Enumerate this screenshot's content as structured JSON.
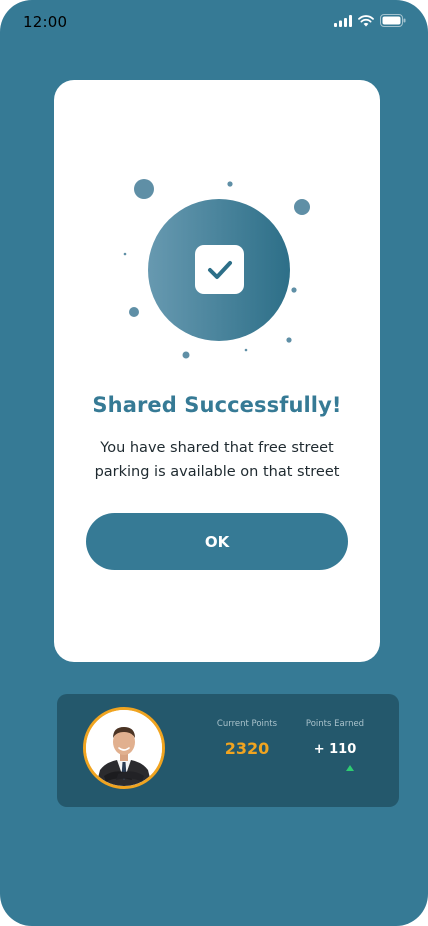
{
  "status_bar": {
    "time": "12:00",
    "icons": [
      "signal-icon",
      "wifi-icon",
      "battery-icon"
    ]
  },
  "modal": {
    "illustration_icon": "check-icon",
    "title": "Shared Successfully!",
    "message": "You have shared that free street parking is available on that street",
    "ok_label": "OK"
  },
  "points_card": {
    "current_points_label": "Current Points",
    "current_points_value": "2320",
    "points_earned_label": "Points Earned",
    "points_earned_value": "+ 110",
    "trend_icon": "up-arrow-icon"
  },
  "colors": {
    "background": "#367a95",
    "accent": "#f0a420",
    "card": "#24586c",
    "trend_up": "#2ecc71"
  }
}
